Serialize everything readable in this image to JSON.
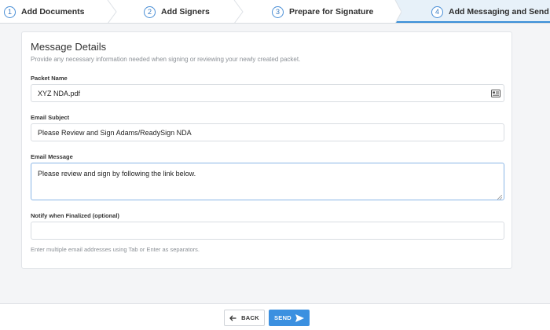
{
  "stepper": {
    "steps": [
      {
        "num": "1",
        "label": "Add Documents"
      },
      {
        "num": "2",
        "label": "Add Signers"
      },
      {
        "num": "3",
        "label": "Prepare for Signature"
      },
      {
        "num": "4",
        "label": "Add Messaging and Send"
      }
    ],
    "active_index": 3,
    "accent": "#3a8fd8"
  },
  "card": {
    "title": "Message Details",
    "subtitle": "Provide any necessary information needed when signing or reviewing your newly created packet.",
    "packet_name": {
      "label": "Packet Name",
      "value": "XYZ NDA.pdf"
    },
    "email_subject": {
      "label": "Email Subject",
      "value": "Please Review and Sign Adams/ReadySign NDA"
    },
    "email_message": {
      "label": "Email Message",
      "value": "Please review and sign by following the link below."
    },
    "notify": {
      "label": "Notify when Finalized (optional)",
      "value": "",
      "help": "Enter multiple email addresses using Tab or Enter as separators."
    }
  },
  "footer": {
    "back_label": "BACK",
    "send_label": "SEND",
    "send_color": "#3b90e0"
  },
  "icons": {
    "packet_field": "id-card-icon",
    "back": "arrow-left-icon",
    "send": "paper-plane-icon"
  }
}
